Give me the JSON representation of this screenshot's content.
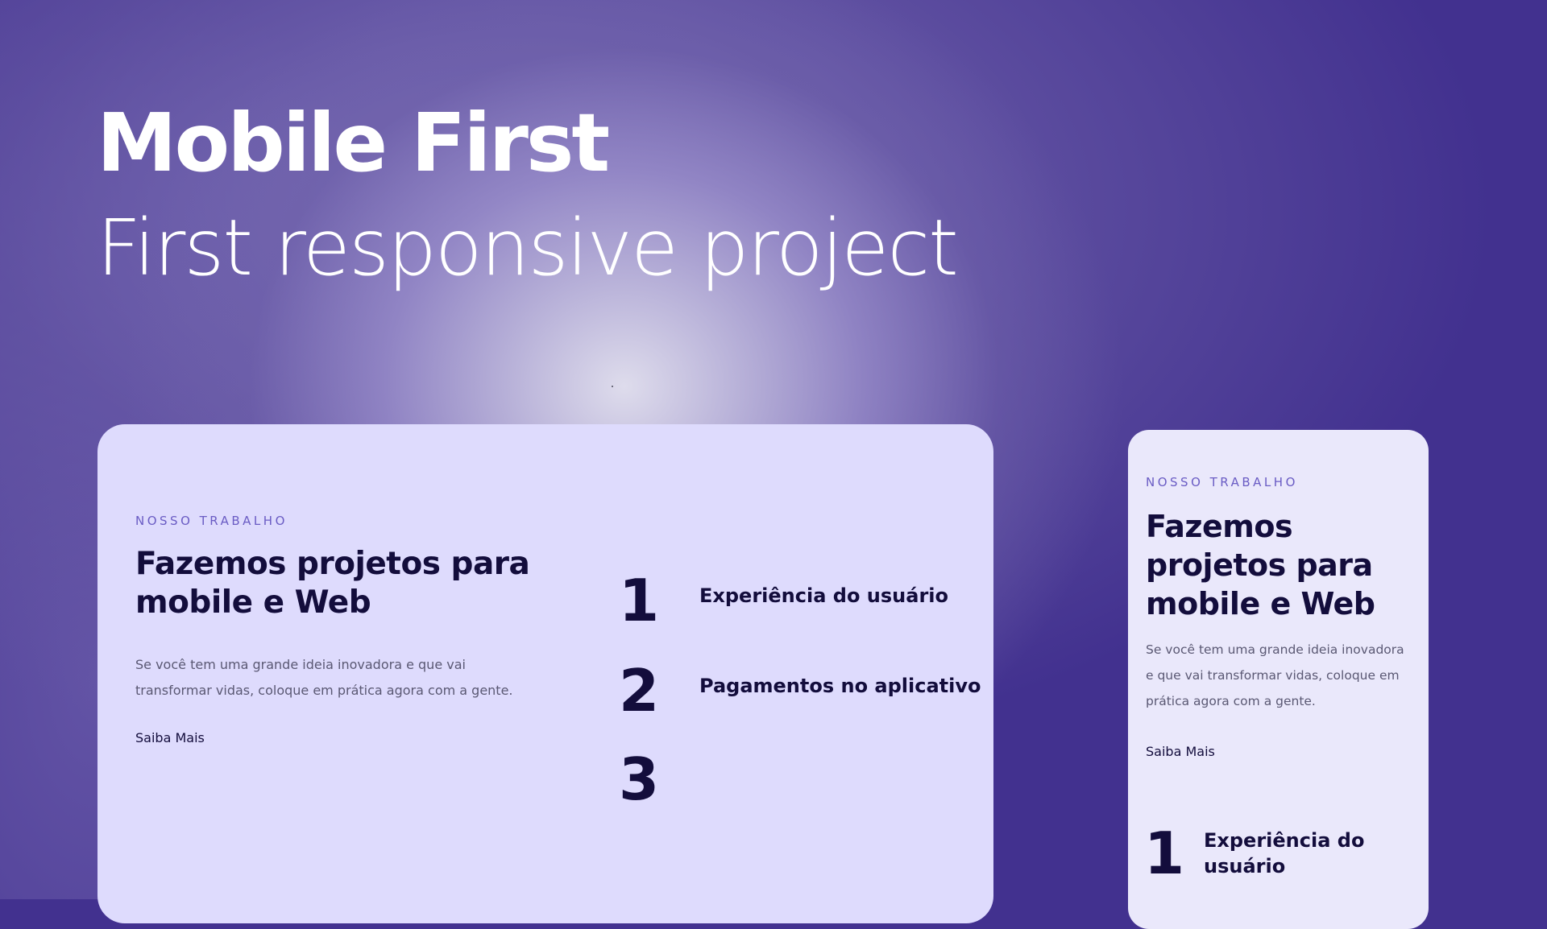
{
  "hero": {
    "title": "Mobile First",
    "subtitle": "First responsive project"
  },
  "desktop_card": {
    "eyebrow": "NOSSO TRABALHO",
    "heading_line1": "Fazemos projetos para",
    "heading_line2": "mobile e Web",
    "body_line1": "Se você tem uma grande ideia inovadora e que vai",
    "body_line2": "transformar vidas, coloque em prática agora com a gente.",
    "link_label": "Saiba Mais",
    "items": [
      {
        "number": "1",
        "label": "Experiência do usuário"
      },
      {
        "number": "2",
        "label": "Pagamentos no aplicativo"
      },
      {
        "number": "3",
        "label": ""
      }
    ]
  },
  "mobile_card": {
    "eyebrow": "NOSSO TRABALHO",
    "heading_line1": "Fazemos",
    "heading_line2": "projetos para",
    "heading_line3": "mobile e Web",
    "body_line1": "Se você tem uma grande ideia inovadora",
    "body_line2": "e que vai transformar vidas, coloque em",
    "body_line3": "prática agora com a gente.",
    "link_label": "Saiba Mais",
    "items": [
      {
        "number": "1",
        "label_line1": "Experiência do",
        "label_line2": "usuário"
      }
    ]
  },
  "colors": {
    "background": "#42318f",
    "card_primary": "#dedbfd",
    "card_secondary": "#eae8fb",
    "text_dark": "#130d3c",
    "eyebrow": "#6a5cc4",
    "body_text": "#5a5873"
  }
}
